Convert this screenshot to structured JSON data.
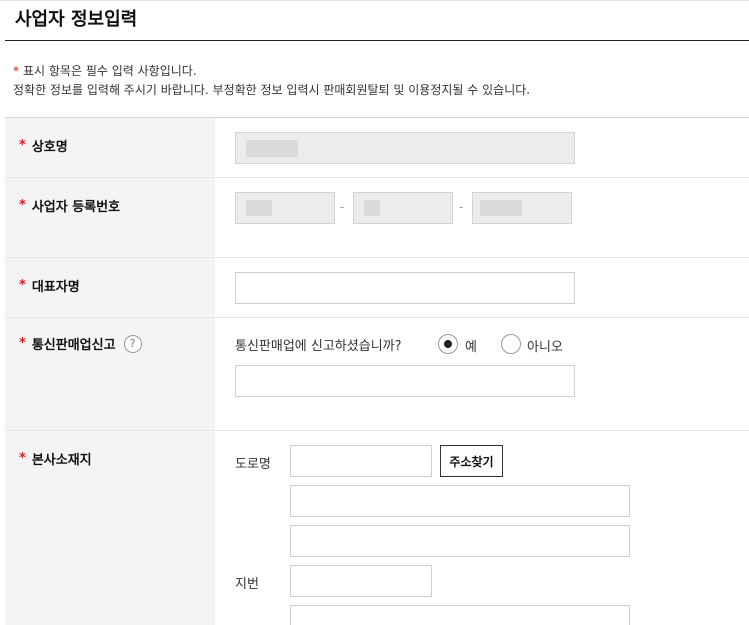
{
  "header": {
    "title": "사업자 정보입력"
  },
  "notice": {
    "required_mark": "*",
    "required_text": "표시 항목은 필수 입력 사항입니다.",
    "info_text": "정확한 정보를 입력해 주시기 바랍니다. 부정확한 정보 입력시 판매회원탈퇴 및 이용정지될 수 있습니다."
  },
  "form": {
    "required_mark": "*",
    "business_name": {
      "label": "상호명",
      "value": ""
    },
    "business_number": {
      "label": "사업자 등록번호",
      "separator": "-"
    },
    "representative": {
      "label": "대표자명",
      "value": ""
    },
    "ecommerce": {
      "label": "통신판매업신고",
      "help_icon": "question-circle-icon",
      "help_glyph": "?",
      "question": "통신판매업에 신고하셨습니까?",
      "options": [
        {
          "label": "예",
          "checked": true
        },
        {
          "label": "아니오",
          "checked": false
        }
      ],
      "value": ""
    },
    "address": {
      "label": "본사소재지",
      "road_label": "도로명",
      "search_button": "주소찾기",
      "lot_label": "지번"
    }
  }
}
